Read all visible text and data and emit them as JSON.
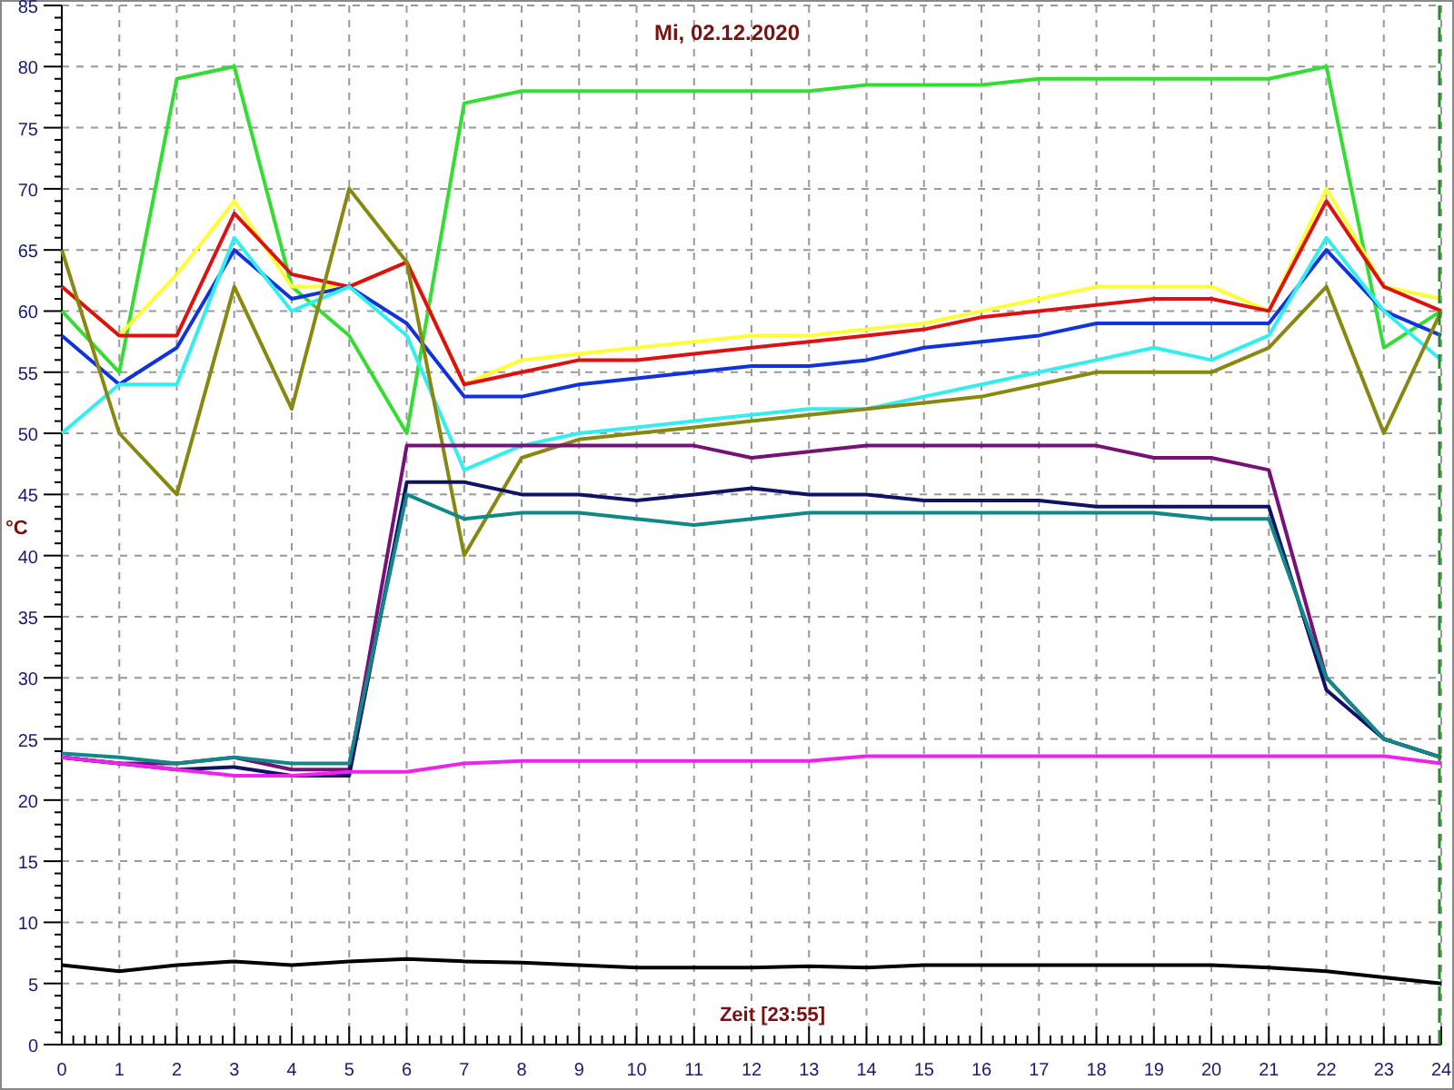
{
  "chart_data": {
    "type": "line",
    "title": "Mi, 02.12.2020",
    "xlabel": "Zeit [23:55]",
    "ylabel": "°C",
    "x": [
      0,
      1,
      2,
      3,
      4,
      5,
      6,
      7,
      8,
      9,
      10,
      11,
      12,
      13,
      14,
      15,
      16,
      17,
      18,
      19,
      20,
      21,
      22,
      23,
      24
    ],
    "series": [
      {
        "color": "#33dd33",
        "values": [
          60,
          55,
          79,
          80,
          62,
          58,
          50,
          77,
          78,
          78,
          78,
          78,
          78,
          78,
          78.5,
          78.5,
          78.5,
          79,
          79,
          79,
          79,
          79,
          80,
          57,
          60
        ]
      },
      {
        "color": "#ffff33",
        "values": [
          62,
          58,
          63,
          69,
          62,
          62,
          64,
          54,
          56,
          56.5,
          57,
          57.5,
          58,
          58,
          58.5,
          59,
          60,
          61,
          62,
          62,
          62,
          60,
          70,
          62,
          61
        ]
      },
      {
        "color": "#dd1111",
        "values": [
          62,
          58,
          58,
          68,
          63,
          62,
          64,
          54,
          55,
          56,
          56,
          56.5,
          57,
          57.5,
          58,
          58.5,
          59.5,
          60,
          60.5,
          61,
          61,
          60,
          69,
          62,
          60
        ]
      },
      {
        "color": "#1133dd",
        "values": [
          58,
          54,
          57,
          65,
          61,
          62,
          59,
          53,
          53,
          54,
          54.5,
          55,
          55.5,
          55.5,
          56,
          57,
          57.5,
          58,
          59,
          59,
          59,
          59,
          65,
          60,
          58
        ]
      },
      {
        "color": "#33eeee",
        "values": [
          50,
          54,
          54,
          66,
          60,
          62,
          58,
          47,
          49,
          50,
          50.5,
          51,
          51.5,
          52,
          52,
          53,
          54,
          55,
          56,
          57,
          56,
          58,
          66,
          60,
          56
        ]
      },
      {
        "color": "#888811",
        "values": [
          65,
          50,
          45,
          62,
          52,
          70,
          64,
          40,
          48,
          49.5,
          50,
          50.5,
          51,
          51.5,
          52,
          52.5,
          53,
          54,
          55,
          55,
          55,
          57,
          62,
          50,
          60
        ]
      },
      {
        "color": "#771177",
        "values": [
          23.5,
          23,
          23,
          23.5,
          22.5,
          22.5,
          49,
          49,
          49,
          49,
          49,
          49,
          48,
          48.5,
          49,
          49,
          49,
          49,
          49,
          48,
          48,
          47,
          30,
          25,
          23.5
        ]
      },
      {
        "color": "#111166",
        "values": [
          23.5,
          23,
          22.5,
          22.7,
          22,
          22,
          46,
          46,
          45,
          45,
          44.5,
          45,
          45.5,
          45,
          45,
          44.5,
          44.5,
          44.5,
          44,
          44,
          44,
          44,
          29,
          25,
          23.5
        ]
      },
      {
        "color": "#118888",
        "values": [
          23.8,
          23.5,
          23,
          23.5,
          23,
          23,
          45,
          43,
          43.5,
          43.5,
          43,
          42.5,
          43,
          43.5,
          43.5,
          43.5,
          43.5,
          43.5,
          43.5,
          43.5,
          43,
          43,
          30,
          25,
          23.5
        ]
      },
      {
        "color": "#ee22ee",
        "values": [
          23.5,
          23,
          22.5,
          22,
          22,
          22.3,
          22.3,
          23,
          23.2,
          23.2,
          23.2,
          23.2,
          23.2,
          23.2,
          23.6,
          23.6,
          23.6,
          23.6,
          23.6,
          23.6,
          23.6,
          23.6,
          23.6,
          23.6,
          23
        ]
      },
      {
        "color": "#000000",
        "values": [
          6.5,
          6,
          6.5,
          6.8,
          6.5,
          6.8,
          7,
          6.8,
          6.7,
          6.5,
          6.3,
          6.3,
          6.3,
          6.4,
          6.3,
          6.5,
          6.5,
          6.5,
          6.5,
          6.5,
          6.5,
          6.3,
          6,
          5.5,
          5
        ]
      }
    ],
    "grid": true,
    "xlim": [
      0,
      24
    ],
    "ylim": [
      0,
      85
    ],
    "xticks": [
      0,
      1,
      2,
      3,
      4,
      5,
      6,
      7,
      8,
      9,
      10,
      11,
      12,
      13,
      14,
      15,
      16,
      17,
      18,
      19,
      20,
      21,
      22,
      23,
      24
    ],
    "yticks": [
      0,
      5,
      10,
      15,
      20,
      25,
      30,
      35,
      40,
      45,
      50,
      55,
      60,
      65,
      70,
      75,
      80,
      85
    ]
  }
}
